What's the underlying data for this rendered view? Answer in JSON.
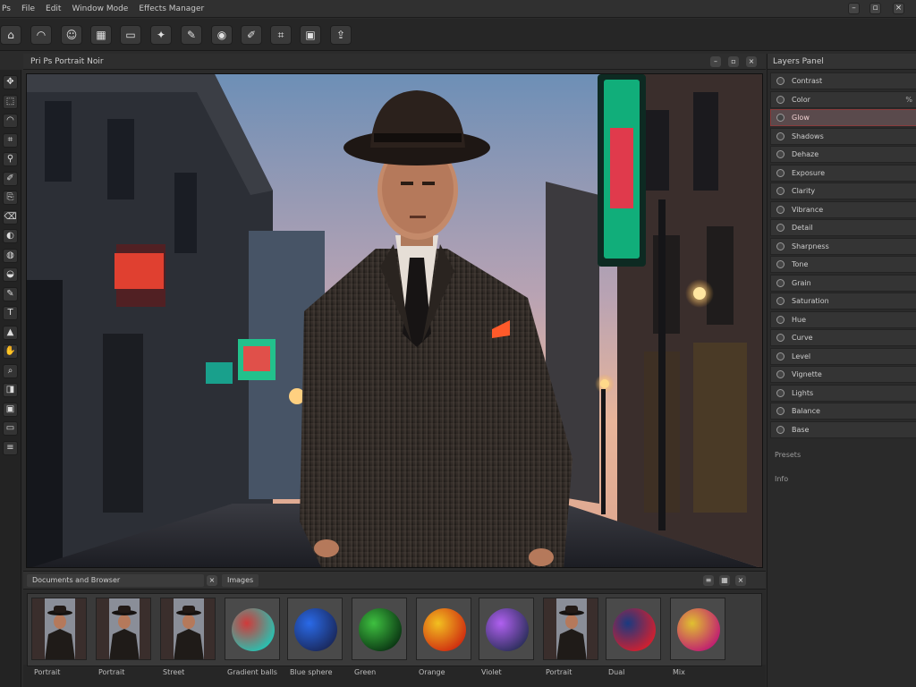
{
  "titlebar": {
    "menu": [
      "Ps",
      "File",
      "Edit",
      "Window Mode",
      "Effects Manager"
    ],
    "controls": [
      "minimize-icon",
      "maximize-icon",
      "close-icon"
    ]
  },
  "toolbar": {
    "tools": [
      {
        "name": "home-icon",
        "glyph": "⌂"
      },
      {
        "name": "lasso-icon",
        "glyph": "◠"
      },
      {
        "name": "portrait-icon",
        "glyph": "☺"
      },
      {
        "name": "grid-icon",
        "glyph": "▦"
      },
      {
        "name": "film-icon",
        "glyph": "▭"
      },
      {
        "name": "effects-icon",
        "glyph": "✦"
      },
      {
        "name": "pen-icon",
        "glyph": "✎"
      },
      {
        "name": "eye-icon",
        "glyph": "◉"
      },
      {
        "name": "brush-icon",
        "glyph": "✐"
      },
      {
        "name": "crop-icon",
        "glyph": "⌗"
      },
      {
        "name": "frame-icon",
        "glyph": "▣"
      },
      {
        "name": "export-icon",
        "glyph": "⇪"
      }
    ]
  },
  "left_tools": [
    "move-icon",
    "select-icon",
    "lasso-icon",
    "crop-icon",
    "eyedropper-icon",
    "brush-icon",
    "clone-icon",
    "eraser-icon",
    "gradient-icon",
    "blur-icon",
    "dodge-icon",
    "pen-icon",
    "text-icon",
    "shape-icon",
    "hand-icon",
    "zoom-icon",
    "fg-bg-icon",
    "mask-icon",
    "screen-icon",
    "layers-icon"
  ],
  "document": {
    "title": "Pri  Ps  Portrait Noir"
  },
  "layers_panel": {
    "title": "Layers Panel",
    "layers": [
      {
        "name": "Contrast",
        "value": ""
      },
      {
        "name": "Color",
        "value": "%"
      },
      {
        "name": "Glow",
        "value": ""
      },
      {
        "name": "Shadows",
        "value": ""
      },
      {
        "name": "Dehaze",
        "value": ""
      },
      {
        "name": "Exposure",
        "value": ""
      },
      {
        "name": "Clarity",
        "value": ""
      },
      {
        "name": "Vibrance",
        "value": ""
      },
      {
        "name": "Detail",
        "value": ""
      },
      {
        "name": "Sharpness",
        "value": ""
      },
      {
        "name": "Tone",
        "value": ""
      },
      {
        "name": "Grain",
        "value": ""
      },
      {
        "name": "Saturation",
        "value": ""
      },
      {
        "name": "Hue",
        "value": ""
      },
      {
        "name": "Curve",
        "value": ""
      },
      {
        "name": "Level",
        "value": ""
      },
      {
        "name": "Vignette",
        "value": ""
      },
      {
        "name": "Lights",
        "value": ""
      },
      {
        "name": "Balance",
        "value": ""
      },
      {
        "name": "Base",
        "value": ""
      }
    ],
    "active_index": 2,
    "extra": [
      "Presets",
      "Info"
    ]
  },
  "bottom_panel": {
    "tab1": "Documents and Browser",
    "tab2": "Images",
    "thumbnails": [
      {
        "label": "Portrait",
        "kind": "portrait"
      },
      {
        "label": "Portrait",
        "kind": "portrait"
      },
      {
        "label": "Street",
        "kind": "portrait"
      },
      {
        "label": "Gradient balls",
        "kind": "sphere",
        "colors": [
          "#d03a3a",
          "#2ac0b0"
        ]
      },
      {
        "label": "Blue sphere",
        "kind": "sphere",
        "colors": [
          "#2a6ae8",
          "#1a2a60"
        ]
      },
      {
        "label": "Green",
        "kind": "sphere",
        "colors": [
          "#3ec040",
          "#0c3a14"
        ]
      },
      {
        "label": "Orange",
        "kind": "sphere",
        "colors": [
          "#f2c020",
          "#d03010"
        ]
      },
      {
        "label": "Violet",
        "kind": "sphere",
        "colors": [
          "#b060f0",
          "#303060"
        ]
      },
      {
        "label": "Portrait",
        "kind": "portrait"
      },
      {
        "label": "Dual",
        "kind": "sphere",
        "colors": [
          "#1a3a80",
          "#d02030"
        ]
      },
      {
        "label": "Mix",
        "kind": "sphere",
        "colors": [
          "#e0c030",
          "#c02070"
        ]
      }
    ]
  }
}
